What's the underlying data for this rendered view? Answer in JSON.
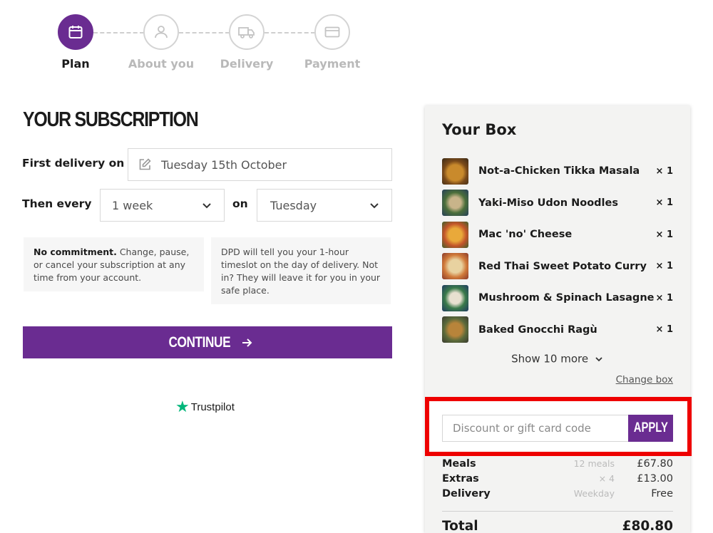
{
  "stepper": {
    "steps": [
      {
        "label": "Plan",
        "icon": "calendar-icon",
        "state": "active"
      },
      {
        "label": "About you",
        "icon": "user-icon",
        "state": "inactive"
      },
      {
        "label": "Delivery",
        "icon": "truck-icon",
        "state": "inactive"
      },
      {
        "label": "Payment",
        "icon": "card-icon",
        "state": "inactive"
      }
    ]
  },
  "subscription": {
    "title": "YOUR SUBSCRIPTION",
    "first_delivery_label": "First delivery on",
    "first_delivery_value": "Tuesday 15th October",
    "then_every_label": "Then every",
    "frequency_value": "1 week",
    "on_label": "on",
    "day_value": "Tuesday",
    "info_commitment_bold": "No commitment.",
    "info_commitment_text": " Change, pause, or cancel your subscription at any time from your account.",
    "info_dpd_text": "DPD will tell you your 1-hour timeslot on the day of delivery. Not in? They will leave it for you in your safe place.",
    "continue_label": "CONTINUE",
    "trustpilot_label": "Trustpilot"
  },
  "box": {
    "title": "Your Box",
    "items": [
      {
        "name": "Not-a-Chicken Tikka Masala",
        "qty": "× 1"
      },
      {
        "name": "Yaki-Miso Udon Noodles",
        "qty": "× 1"
      },
      {
        "name": "Mac 'no' Cheese",
        "qty": "× 1"
      },
      {
        "name": "Red Thai Sweet Potato Curry",
        "qty": "× 1"
      },
      {
        "name": "Mushroom & Spinach Lasagne",
        "qty": "× 1"
      },
      {
        "name": "Baked Gnocchi Ragù",
        "qty": "× 1"
      }
    ],
    "show_more_label": "Show 10 more",
    "change_box_label": "Change box",
    "discount_placeholder": "Discount or gift card code",
    "apply_label": "APPLY",
    "summary": [
      {
        "label": "Meals",
        "meta": "12 meals",
        "value": "£67.80"
      },
      {
        "label": "Extras",
        "meta": "× 4",
        "value": "£13.00"
      },
      {
        "label": "Delivery",
        "meta": "Weekday",
        "value": "Free"
      }
    ],
    "total_label": "Total",
    "total_value": "£80.80"
  },
  "colors": {
    "brand_purple": "#6a2c91",
    "highlight_red": "#ee0000",
    "trustpilot_green": "#00b67a"
  }
}
